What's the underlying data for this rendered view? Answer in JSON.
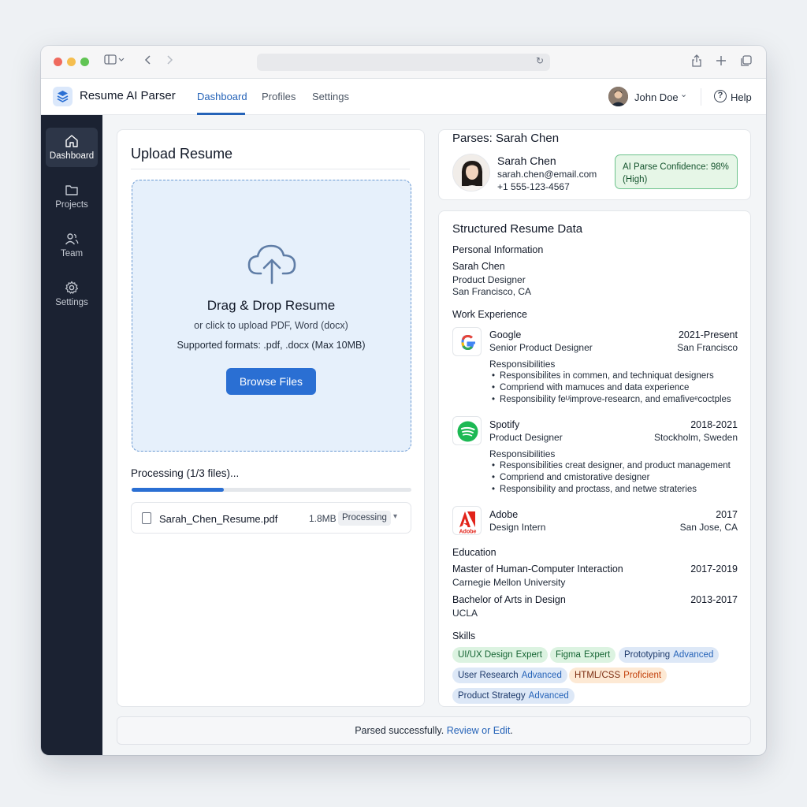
{
  "app": {
    "name": "Resume AI Parser",
    "nav": [
      "Dashboard",
      "Profiles",
      "Settings"
    ],
    "active_nav": "Dashboard",
    "user": "John Doe",
    "help": "Help"
  },
  "sidebar": {
    "items": [
      {
        "label": "Dashboard",
        "icon": "home-icon",
        "active": true
      },
      {
        "label": "Projects",
        "icon": "folder-icon",
        "active": false
      },
      {
        "label": "Team",
        "icon": "users-icon",
        "active": false
      },
      {
        "label": "Settings",
        "icon": "gear-icon",
        "active": false
      }
    ]
  },
  "upload": {
    "title": "Upload Resume",
    "drop_title": "Drag & Drop Resume",
    "drop_subtitle": "or click to upload PDF, Word (docx)",
    "formats": "Supported formats: .pdf, .docx (Max 10MB)",
    "browse_label": "Browse Files",
    "processing_label": "Processing (1/3 files)...",
    "progress_fraction": 0.33,
    "file": {
      "name": "Sarah_Chen_Resume.pdf",
      "size": "1.8MB",
      "status": "Processing"
    }
  },
  "profile": {
    "title": "Parses: Sarah Chen",
    "name": "Sarah Chen",
    "email": "sarah.chen@email.com",
    "phone": "+1 555-123-4567",
    "confidence_line1": "AI Parse Confidence: 98%",
    "confidence_line2": "(High)"
  },
  "resume": {
    "title": "Structured Resume Data",
    "personal_heading": "Personal Information",
    "personal": {
      "name": "Sarah Chen",
      "role": "Product Designer",
      "location": "San Francisco, CA"
    },
    "work_heading": "Work Experience",
    "responsibilities_label": "Responsibilities",
    "jobs": [
      {
        "company": "Google",
        "title": "Senior Product Designer",
        "dates": "2021-Present",
        "location": "San Francisco",
        "bullets": [
          "Responsibilites in commen, and techniquat designers",
          "Compriend with mamuces and data experience",
          "Responsibility feᵁimprove-researcn, and emafiveᵉcoctples"
        ]
      },
      {
        "company": "Spotify",
        "title": "Product Designer",
        "dates": "2018-2021",
        "location": "Stockholm, Sweden",
        "bullets": [
          "Responsibilities creat designer, and product management",
          "Compriend and cmistorative designer",
          "Responsibility and proctass, and netwe strateries"
        ]
      },
      {
        "company": "Adobe",
        "title": "Design Intern",
        "dates": "2017",
        "location": "San Jose, CA",
        "logo_text": "Adobe",
        "bullets": []
      }
    ],
    "education_heading": "Education",
    "education": [
      {
        "degree": "Master of Human-Computer Interaction",
        "school": "Carnegie Mellon University",
        "dates": "2017-2019"
      },
      {
        "degree": "Bachelor of Arts in Design",
        "school": "UCLA",
        "dates": "2013-2017"
      }
    ],
    "skills_heading": "Skills",
    "skills": [
      {
        "name": "UI/UX Design",
        "level": "Expert",
        "color": "green"
      },
      {
        "name": "Figma",
        "level": "Expert",
        "color": "green"
      },
      {
        "name": "Prototyping",
        "level": "Advanced",
        "color": "blue"
      },
      {
        "name": "User Research",
        "level": "Advanced",
        "color": "blue"
      },
      {
        "name": "HTML/CSS",
        "level": "Proficient",
        "color": "orange"
      },
      {
        "name": "Product Strategy",
        "level": "Advanced",
        "color": "blue"
      }
    ]
  },
  "footer": {
    "text": "Parsed successfully.",
    "link": "Review or Edit",
    "end": "."
  },
  "colors": {
    "accent": "#2a6fd3",
    "sidebar": "#1b2232",
    "success": "#6cc28b"
  }
}
